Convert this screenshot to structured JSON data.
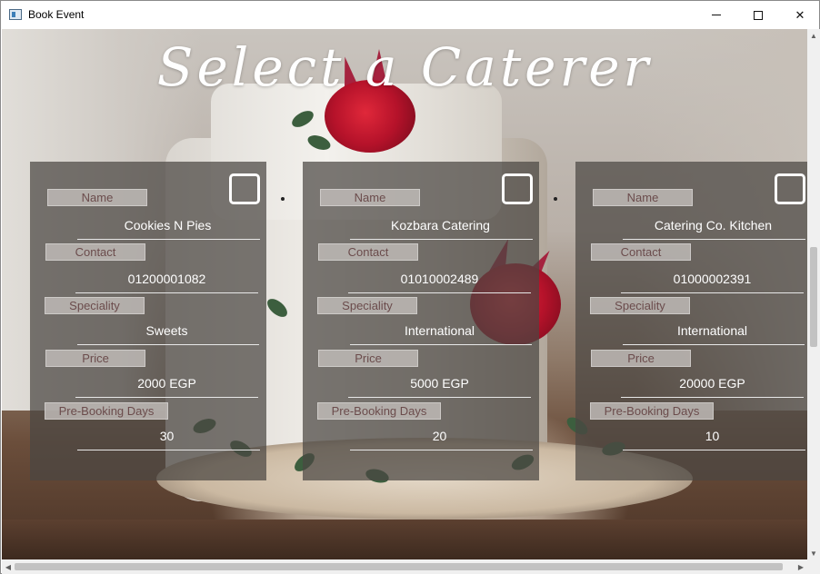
{
  "window": {
    "title": "Book Event",
    "minimize_label": "",
    "maximize_label": "",
    "close_label": "✕"
  },
  "page": {
    "heading": "Select a Caterer"
  },
  "labels": {
    "name": "Name",
    "contact": "Contact",
    "speciality": "Speciality",
    "price": "Price",
    "prebooking": "Pre-Booking Days"
  },
  "caterers": [
    {
      "name": "Cookies N Pies",
      "contact": "01200001082",
      "speciality": "Sweets",
      "price": "2000 EGP",
      "prebooking": "30",
      "selected": false
    },
    {
      "name": "Kozbara Catering",
      "contact": "01010002489",
      "speciality": "International",
      "price": "5000 EGP",
      "prebooking": "20",
      "selected": false
    },
    {
      "name": "Catering Co. Kitchen",
      "contact": "01000002391",
      "speciality": "International",
      "price": "20000 EGP",
      "prebooking": "10",
      "selected": false
    }
  ],
  "scrollbars": {
    "up_arrow": "▲",
    "down_arrow": "▼",
    "left_arrow": "◀",
    "right_arrow": "▶"
  },
  "icons": {
    "app": "window-app-icon",
    "minimize": "minimize-icon",
    "maximize": "maximize-icon",
    "close": "close-icon"
  },
  "colors": {
    "card_bg": "#4b4642",
    "label_bg": "#bebab6",
    "label_text": "#6b4c4c",
    "value_text": "#ffffff",
    "heading_text": "#ffffff"
  }
}
